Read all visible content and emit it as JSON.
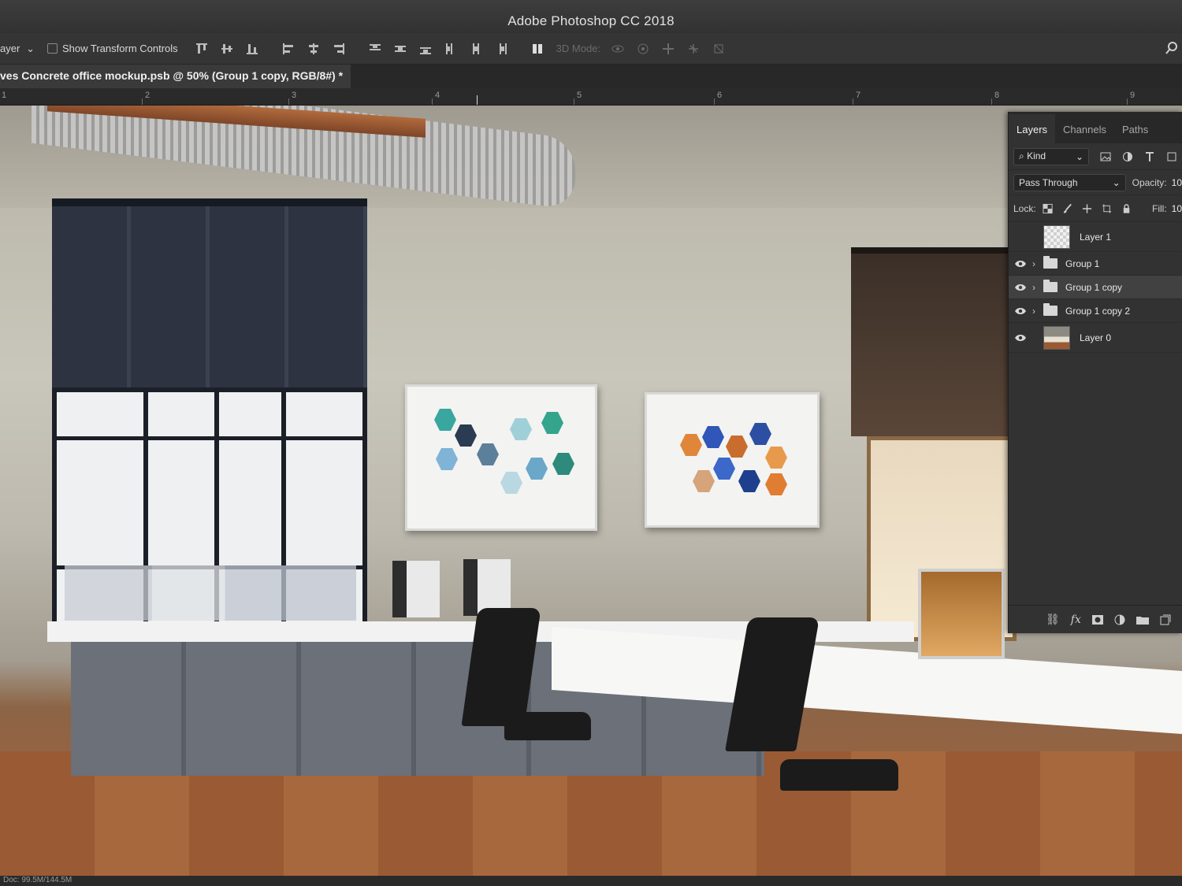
{
  "app": {
    "title": "Adobe Photoshop CC 2018"
  },
  "options_bar": {
    "layer_select": "ayer",
    "show_transform_controls": "Show Transform Controls",
    "mode_3d": "3D Mode:"
  },
  "document": {
    "tab_title": "ves Concrete office mockup.psb @ 50% (Group 1 copy, RGB/8#) *"
  },
  "ruler": {
    "numbers": [
      "1",
      "2",
      "3",
      "4",
      "5",
      "6",
      "7",
      "8",
      "9"
    ]
  },
  "layers_panel": {
    "tabs": [
      "Layers",
      "Channels",
      "Paths"
    ],
    "filter_kind": "Kind",
    "blend_mode": "Pass Through",
    "opacity_label": "Opacity:",
    "opacity_value": "10",
    "lock_label": "Lock:",
    "fill_label": "Fill:",
    "fill_value": "10",
    "layers": [
      {
        "name": "Layer 1",
        "type": "pixel",
        "visible": false
      },
      {
        "name": "Group 1",
        "type": "group",
        "visible": true
      },
      {
        "name": "Group 1 copy",
        "type": "group",
        "visible": true,
        "selected": true
      },
      {
        "name": "Group 1 copy 2",
        "type": "group",
        "visible": true
      },
      {
        "name": "Layer 0",
        "type": "pixel",
        "visible": true
      }
    ],
    "footer_icons": [
      "link-icon",
      "fx-icon",
      "mask-icon",
      "adjustment-icon",
      "folder-icon",
      "new-layer-icon"
    ]
  },
  "status": {
    "doc_size": "Doc: 99.5M/144.5M"
  }
}
